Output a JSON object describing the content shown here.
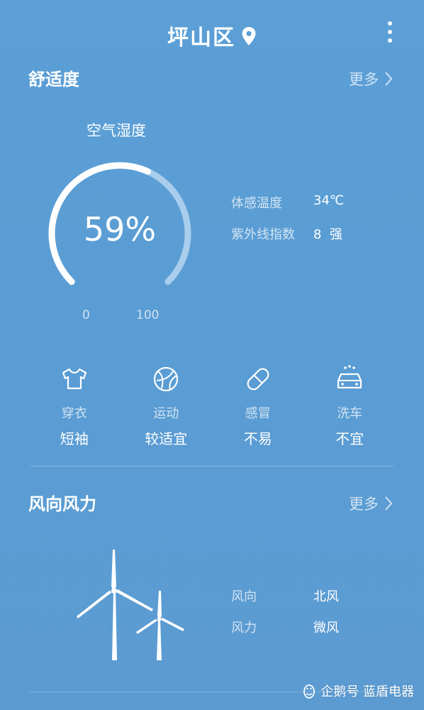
{
  "header": {
    "location": "坪山区",
    "pin_icon": "location-pin-icon",
    "menu_icon": "more-vert-icon"
  },
  "comfort": {
    "title": "舒适度",
    "more_label": "更多",
    "gauge": {
      "title": "空气湿度",
      "value_text": "59%",
      "value": 59,
      "min_label": "0",
      "max_label": "100"
    },
    "info": [
      {
        "label": "体感温度",
        "value": "34℃"
      },
      {
        "label": "紫外线指数",
        "value": "8  强"
      }
    ],
    "tiles": [
      {
        "icon": "tshirt-icon",
        "label": "穿衣",
        "value": "短袖"
      },
      {
        "icon": "ball-icon",
        "label": "运动",
        "value": "较适宜"
      },
      {
        "icon": "pill-icon",
        "label": "感冒",
        "value": "不易"
      },
      {
        "icon": "car-wash-icon",
        "label": "洗车",
        "value": "不宜"
      }
    ]
  },
  "wind": {
    "title": "风向风力",
    "more_label": "更多",
    "icon": "wind-turbine-icon",
    "info": [
      {
        "label": "风向",
        "value": "北风"
      },
      {
        "label": "风力",
        "value": "微风"
      }
    ]
  },
  "watermark": {
    "text": "企鹅号 蓝盾电器",
    "icon": "penguin-icon"
  },
  "colors": {
    "background": "#5b9fd6",
    "arc_active": "#ffffff",
    "arc_inactive": "#a9cdec"
  }
}
